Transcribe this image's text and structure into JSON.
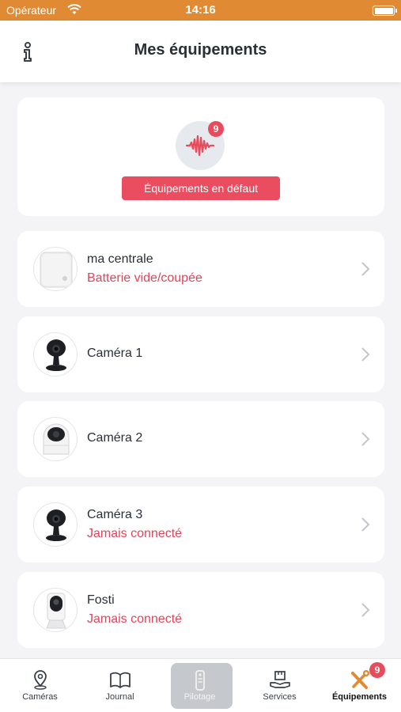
{
  "status_bar": {
    "carrier": "Opérateur",
    "time": "14:16"
  },
  "header": {
    "title": "Mes équipements"
  },
  "fault_card": {
    "badge_count": "9",
    "button_label": "Équipements en défaut"
  },
  "devices": [
    {
      "name": "ma centrale",
      "status": "Batterie vide/coupée"
    },
    {
      "name": "Caméra 1",
      "status": ""
    },
    {
      "name": "Caméra 2",
      "status": ""
    },
    {
      "name": "Caméra 3",
      "status": "Jamais connecté"
    },
    {
      "name": "Fosti",
      "status": "Jamais connecté"
    }
  ],
  "tab_bar": {
    "tabs": [
      {
        "label": "Caméras",
        "icon": "location-pin-icon"
      },
      {
        "label": "Journal",
        "icon": "book-icon"
      },
      {
        "label": "Pilotage",
        "icon": "remote-icon"
      },
      {
        "label": "Services",
        "icon": "hand-box-icon"
      },
      {
        "label": "Équipements",
        "icon": "tools-icon",
        "badge": "9"
      }
    ],
    "active": "Équipements"
  },
  "colors": {
    "accent": "#e08a33",
    "alert": "#ea4d60",
    "status_text": "#e1455a"
  }
}
